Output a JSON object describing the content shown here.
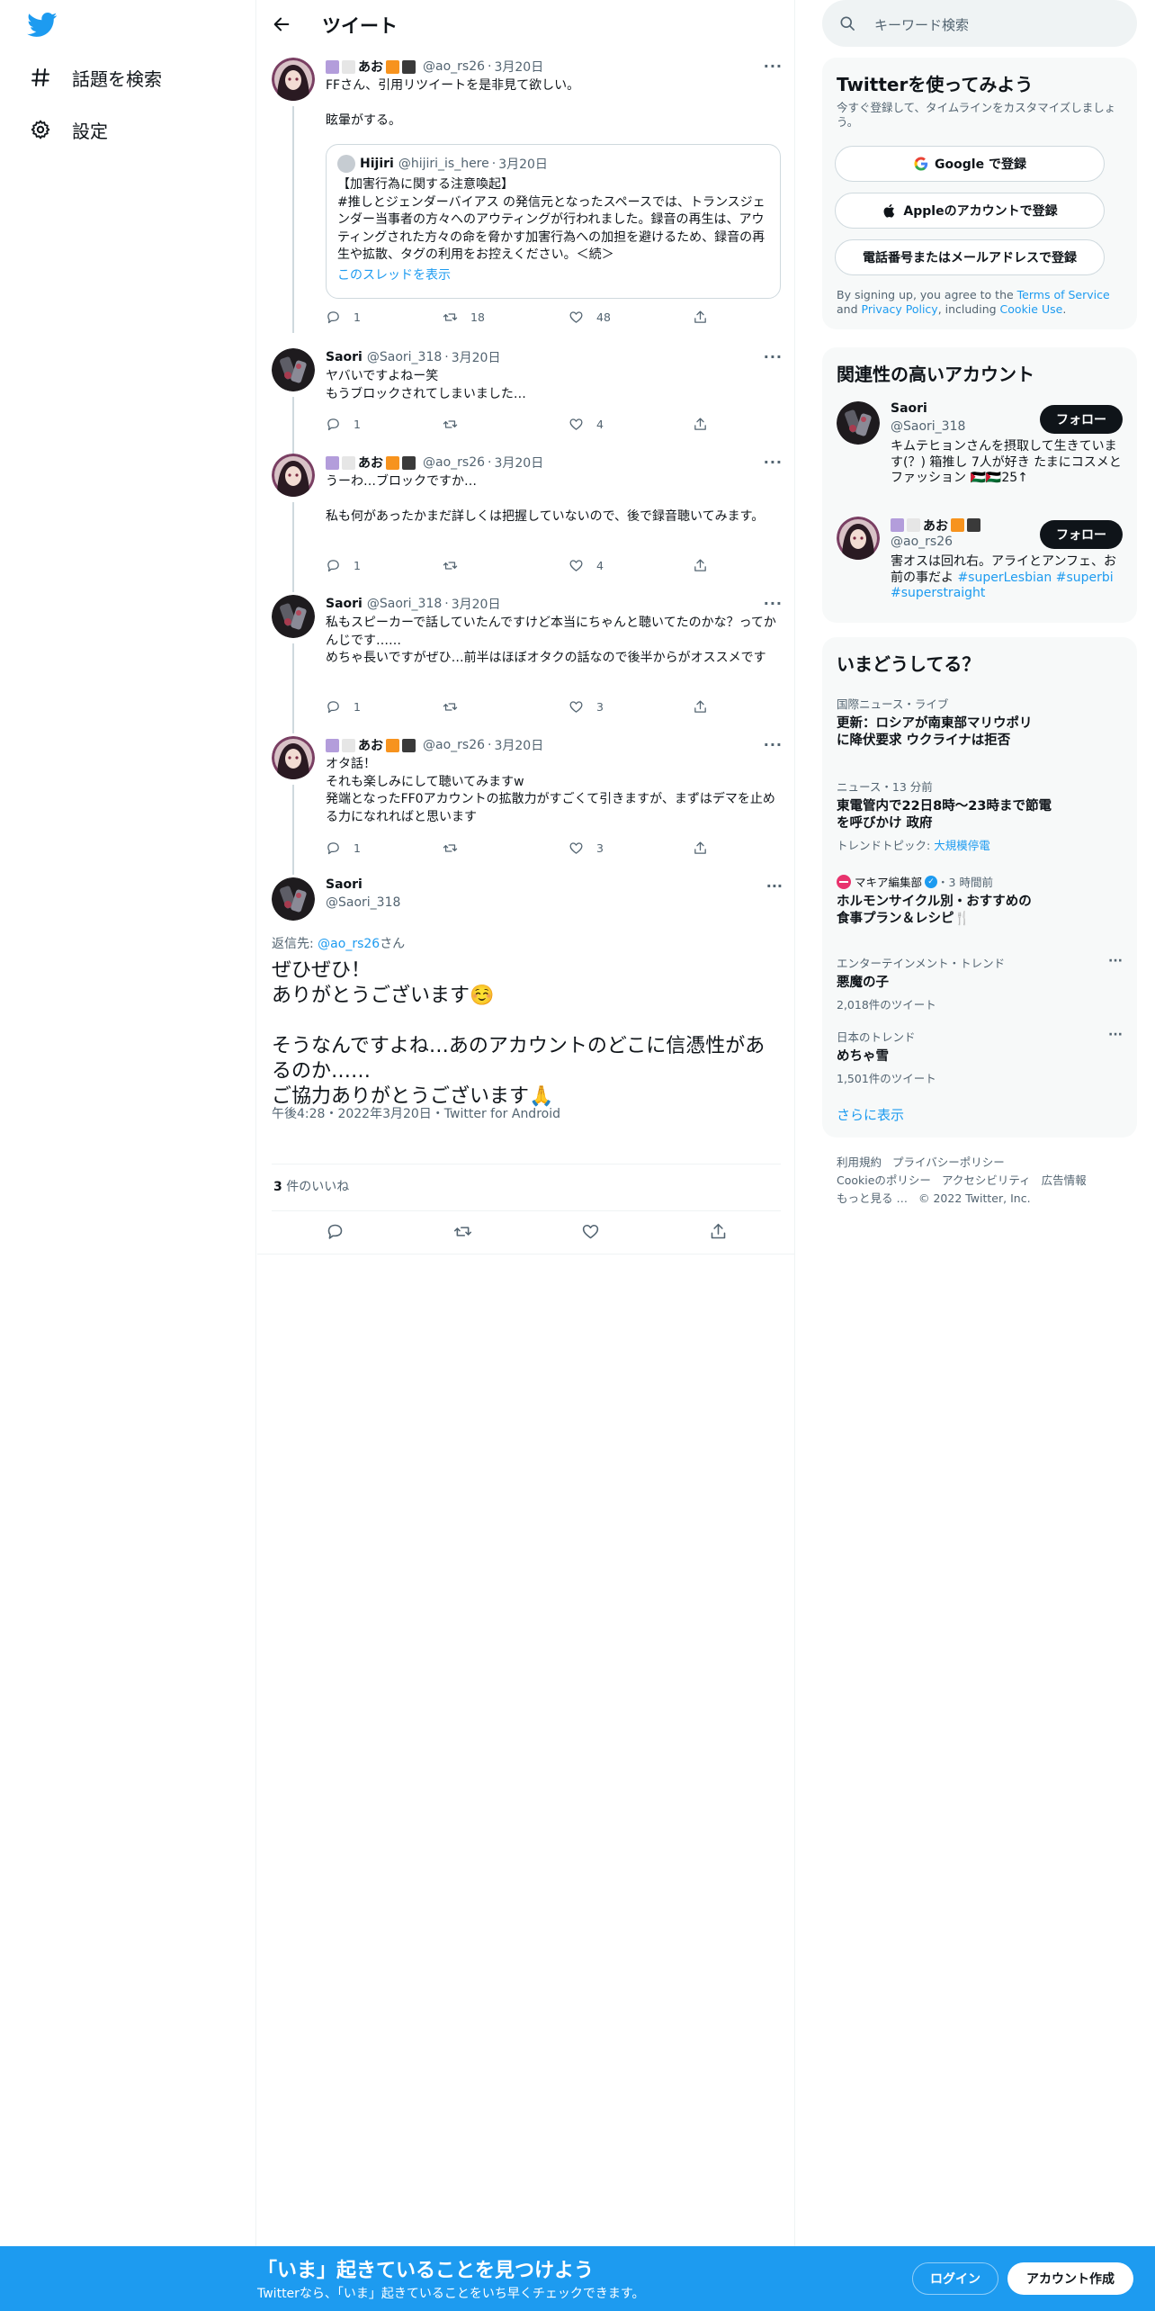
{
  "nav": {
    "explore": "話題を検索",
    "settings": "設定"
  },
  "header": {
    "title": "ツイート"
  },
  "tweets": [
    {
      "name": "あお",
      "handle": "@ao_rs26",
      "date": "3月20日",
      "body": "FFさん、引用リツイートを是非見て欲しい。\n\n眩暈がする。",
      "quote": {
        "name": "Hijiri",
        "handle": "@hijiri_is_here",
        "date": "3月20日",
        "body": "【加害行為に関する注意喚起】\n#推しとジェンダーバイアス の発信元となったスペースでは、トランスジェンダー当事者の方々へのアウティングが行われました。録音の再生は、アウティングされた方々の命を脅かす加害行為への加担を避けるため、録音の再生や拡散、タグの利用をお控えください。＜続＞",
        "link": "このスレッドを表示"
      },
      "replies": "1",
      "retweets": "18",
      "likes": "48"
    },
    {
      "name": "Saori",
      "handle": "@Saori_318",
      "date": "3月20日",
      "body": "ヤバいですよねー笑\nもうブロックされてしまいました…",
      "replies": "1",
      "retweets": "",
      "likes": "4"
    },
    {
      "name": "あお",
      "handle": "@ao_rs26",
      "date": "3月20日",
      "body": "うーわ…ブロックですか…\n\n私も何があったかまだ詳しくは把握していないので、後で録音聴いてみます。",
      "replies": "1",
      "retweets": "",
      "likes": "4"
    },
    {
      "name": "Saori",
      "handle": "@Saori_318",
      "date": "3月20日",
      "body": "私もスピーカーで話していたんですけど本当にちゃんと聴いてたのかな？ってかんじです……\nめちゃ長いですがぜひ…前半はほぼオタクの話なので後半からがオススメです",
      "replies": "1",
      "retweets": "",
      "likes": "3"
    },
    {
      "name": "あお",
      "handle": "@ao_rs26",
      "date": "3月20日",
      "body": "オタ話！\nそれも楽しみにして聴いてみますw\n発端となったFF0アカウントの拡散力がすごくて引きますが、まずはデマを止める力になれればと思います",
      "replies": "1",
      "retweets": "",
      "likes": "3"
    }
  ],
  "main_tweet": {
    "name": "Saori",
    "handle": "@Saori_318",
    "replying_prefix": "返信先: ",
    "replying_to": "@ao_rs26",
    "replying_suffix": "さん",
    "text": "ぜひぜひ！\nありがとうございます☺️\n\nそうなんですよね…あのアカウントのどこに信憑性があるのか……\nご協力ありがとうございます🙏",
    "meta": "午後4:28・2022年3月20日・Twitter for Android",
    "likes_count": "3",
    "likes_label": " 件のいいね"
  },
  "search": {
    "placeholder": "キーワード検索"
  },
  "signup_card": {
    "title": "Twitterを使ってみよう",
    "subtitle": "今すぐ登録して、タイムラインをカスタマイズしましょう。",
    "google": "Google で登録",
    "apple": "Appleのアカウントで登録",
    "phone": "電話番号またはメールアドレスで登録",
    "terms_a": "By signing up, you agree to the ",
    "terms_tos": "Terms of Service",
    "terms_b": " and ",
    "terms_pp": "Privacy Policy",
    "terms_c": ", including ",
    "terms_cookie": "Cookie Use",
    "terms_d": "."
  },
  "related": {
    "title": "関連性の高いアカウント",
    "follow_label": "フォロー",
    "accounts": [
      {
        "name": "Saori",
        "handle": "@Saori_318",
        "bio": "キムテヒョンさんを摂取して生きています(？) 箱推し 7人が好き たまにコスメとファッション 🇵🇸🇵🇸25↑"
      },
      {
        "name": "あお",
        "handle": "@ao_rs26",
        "bio": "害オスは回れ右。アライとアンフェ、お前の事だよ ",
        "tag1": "#superLesbian",
        "tag2": "#superbi",
        "tag3": "#superstraight"
      }
    ]
  },
  "trends": {
    "title": "いまどうしてる？",
    "items": [
      {
        "context": "国際ニュース・ライブ",
        "title": "更新：ロシアが南東部マリウポリに降伏要求 ウクライナは拒否"
      },
      {
        "context": "ニュース・13 分前",
        "title": "東電管内で22日8時～23時まで節電を呼びかけ 政府",
        "sub_prefix": "トレンドトピック: ",
        "sub_link": "大規模停電"
      },
      {
        "context_name": "マキア編集部",
        "context_time": "・3 時間前",
        "title": "ホルモンサイクル別・おすすめの食事プラン＆レシピ🍴"
      },
      {
        "context": "エンターテインメント・トレンド",
        "title": "悪魔の子",
        "sub": "2,018件のツイート"
      },
      {
        "context": "日本のトレンド",
        "title": "めちゃ雪",
        "sub": "1,501件のツイート"
      }
    ],
    "show_more": "さらに表示"
  },
  "footer": {
    "terms": "利用規約",
    "privacy": "プライバシーポリシー",
    "cookie": "Cookieのポリシー",
    "accessibility": "アクセシビリティ",
    "ads": "広告情報",
    "more": "もっと見る …",
    "copyright": "© 2022 Twitter, Inc."
  },
  "bottom": {
    "title": "「いま」起きていることを見つけよう",
    "subtitle": "Twitterなら、「いま」起きていることをいち早くチェックできます。",
    "login": "ログイン",
    "signup": "アカウント作成"
  },
  "colors": {
    "accent": "#1d9bf0",
    "sq_purple": "#b39ddb",
    "sq_white": "#e6e6e6",
    "sq_orange": "#f7931e",
    "sq_dark": "#3a3a3a"
  }
}
